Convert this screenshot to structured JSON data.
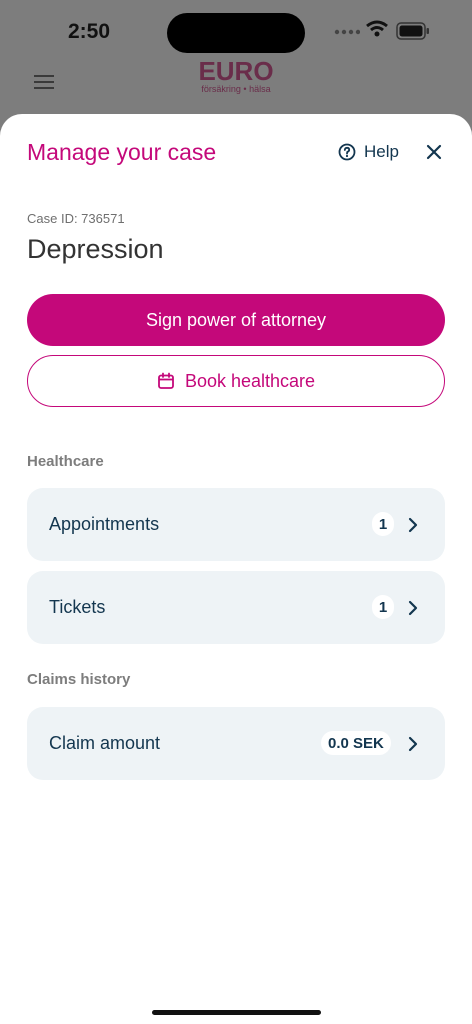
{
  "status": {
    "time": "2:50"
  },
  "brand": {
    "logo_main": "EURO",
    "logo_sub": "försäkring • hälsa"
  },
  "sheet": {
    "title": "Manage your case",
    "help_label": "Help",
    "case_id": "Case ID: 736571",
    "case_title": "Depression",
    "primary_button": "Sign power of attorney",
    "secondary_button": "Book healthcare"
  },
  "healthcare": {
    "section_label": "Healthcare",
    "items": [
      {
        "label": "Appointments",
        "count": "1"
      },
      {
        "label": "Tickets",
        "count": "1"
      }
    ]
  },
  "claims": {
    "section_label": "Claims history",
    "items": [
      {
        "label": "Claim amount",
        "value": "0.0 SEK"
      }
    ]
  },
  "colors": {
    "accent": "#c4087a",
    "text_dark": "#13364f",
    "row_bg": "#eef3f6"
  }
}
